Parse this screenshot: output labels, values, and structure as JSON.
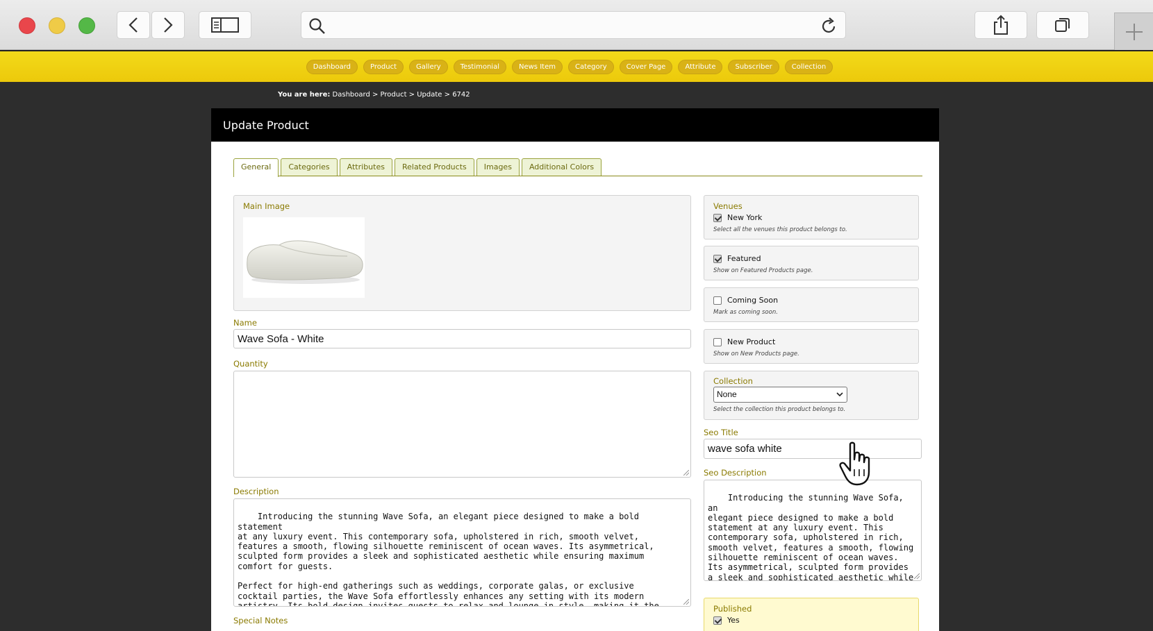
{
  "browser": {
    "url": ""
  },
  "nav": [
    "Dashboard",
    "Product",
    "Gallery",
    "Testimonial",
    "News Item",
    "Category",
    "Cover Page",
    "Attribute",
    "Subscriber",
    "Collection"
  ],
  "breadcrumb": {
    "prefix": "You are here:",
    "trail": "Dashboard > Product > Update > 6742"
  },
  "panel": {
    "title": "Update Product"
  },
  "tabs": [
    "General",
    "Categories",
    "Attributes",
    "Related Products",
    "Images",
    "Additional Colors"
  ],
  "form": {
    "main_image_label": "Main Image",
    "name_label": "Name",
    "name_value": "Wave Sofa - White",
    "quantity_label": "Quantity",
    "quantity_value": "",
    "description_label": "Description",
    "description_value": "Introducing the stunning Wave Sofa, an elegant piece designed to make a bold statement\nat any luxury event. This contemporary sofa, upholstered in rich, smooth velvet,\nfeatures a smooth, flowing silhouette reminiscent of ocean waves. Its asymmetrical,\nsculpted form provides a sleek and sophisticated aesthetic while ensuring maximum\ncomfort for guests.\n\nPerfect for high-end gatherings such as weddings, corporate galas, or exclusive\ncocktail parties, the Wave Sofa effortlessly enhances any setting with its modern\nartistry. Its bold design invites guests to relax and lounge in style, making it the\nideal centerpiece for any chic, upscale event.",
    "special_notes_label": "Special Notes"
  },
  "side": {
    "venues_label": "Venues",
    "venues_option": "New York",
    "venues_hint": "Select all the venues this product belongs to.",
    "featured_label": "Featured",
    "featured_hint": "Show on Featured Products page.",
    "coming_soon_label": "Coming Soon",
    "coming_soon_hint": "Mark as coming soon.",
    "new_product_label": "New Product",
    "new_product_hint": "Show on New Products page.",
    "collection_label": "Collection",
    "collection_value": "None",
    "collection_hint": "Select the collection this product belongs to.",
    "seo_title_label": "Seo Title",
    "seo_title_value": "wave sofa white",
    "seo_description_label": "Seo Description",
    "seo_description_value": "Introducing the stunning Wave Sofa, an\nelegant piece designed to make a bold\nstatement at any luxury event. This\ncontemporary sofa, upholstered in rich,\nsmooth velvet, features a smooth, flowing\nsilhouette reminiscent of ocean waves.\nIts asymmetrical, sculpted form provides\na sleek and sophisticated aesthetic while\nensuring maximum comfort for guests.",
    "published_label": "Published",
    "published_option": "Yes"
  },
  "colors": {
    "accent": "#f0d012",
    "label": "#8a7a00",
    "tab": "#6b6a10"
  }
}
